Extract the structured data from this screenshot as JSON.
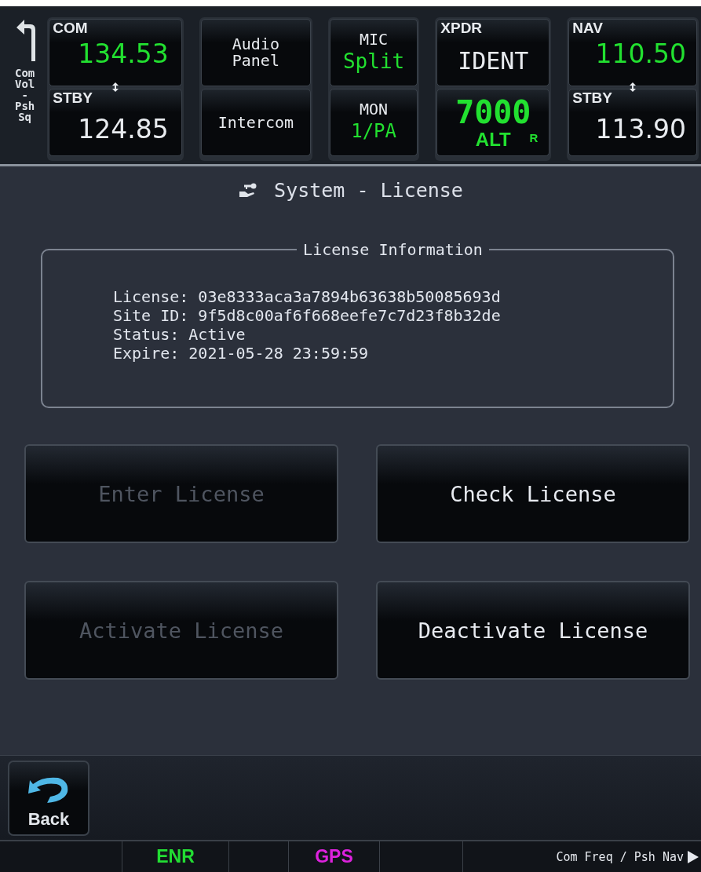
{
  "top_bar": {
    "knob_label": [
      "Com",
      "Vol",
      "-",
      "Psh",
      "Sq"
    ],
    "com": {
      "label": "COM",
      "active": "134.53",
      "standby_label": "STBY",
      "standby": "124.85"
    },
    "audio": {
      "upper": "Audio Panel",
      "lower": "Intercom"
    },
    "mic": {
      "label": "MIC",
      "value": "Split",
      "mon_label": "MON",
      "mon_value": "1/PA"
    },
    "xpdr": {
      "label": "XPDR",
      "ident": "IDENT",
      "code": "7000",
      "mode": "ALT",
      "reply": "R"
    },
    "nav": {
      "label": "NAV",
      "active": "110.50",
      "standby_label": "STBY",
      "standby": "113.90"
    }
  },
  "page_title": "System - License",
  "license_info": {
    "title": "License Information",
    "lines": [
      "License: 03e8333aca3a7894b63638b50085693d",
      "Site ID: 9f5d8c00af6f668eefe7c7d23f8b32de",
      "Status: Active",
      "Expire: 2021-05-28 23:59:59"
    ]
  },
  "buttons": [
    {
      "label": "Enter License",
      "disabled": true
    },
    {
      "label": "Check License",
      "disabled": false
    },
    {
      "label": "Activate License",
      "disabled": true
    },
    {
      "label": "Deactivate License",
      "disabled": false
    }
  ],
  "back_button": {
    "label": "Back"
  },
  "status_bar": {
    "fields": [
      {
        "text": "ENR",
        "color": "#22dd33"
      },
      {
        "text": "GPS",
        "color": "#dd22dd"
      }
    ],
    "hint": "Com Freq / Psh Nav"
  }
}
